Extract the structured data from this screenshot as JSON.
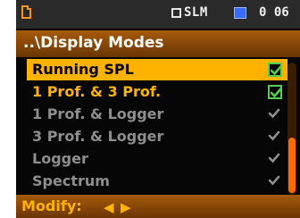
{
  "status_bar": {
    "file_icon": "file-icon",
    "mode_label": "SLM",
    "battery_icon": "battery-icon",
    "clock": "0 06"
  },
  "title": "..\\Display Modes",
  "items": [
    {
      "label": "Running SPL",
      "enabled": true,
      "selected": true
    },
    {
      "label": "1 Prof. & 3 Prof.",
      "enabled": true,
      "selected": false
    },
    {
      "label": "1 Prof. & Logger",
      "enabled": false,
      "selected": false
    },
    {
      "label": "3 Prof. & Logger",
      "enabled": false,
      "selected": false
    },
    {
      "label": "Logger",
      "enabled": false,
      "selected": false
    },
    {
      "label": "Spectrum",
      "enabled": false,
      "selected": false
    }
  ],
  "footer": {
    "label": "Modify:",
    "left_arrow": "◀",
    "right_arrow": "▶"
  },
  "colors": {
    "accent": "#ffb300",
    "title_bar": "#8a4a06",
    "check_on": "#4fd14f",
    "check_off": "#8e8e8e",
    "scroll_thumb": "#ff6a00"
  }
}
